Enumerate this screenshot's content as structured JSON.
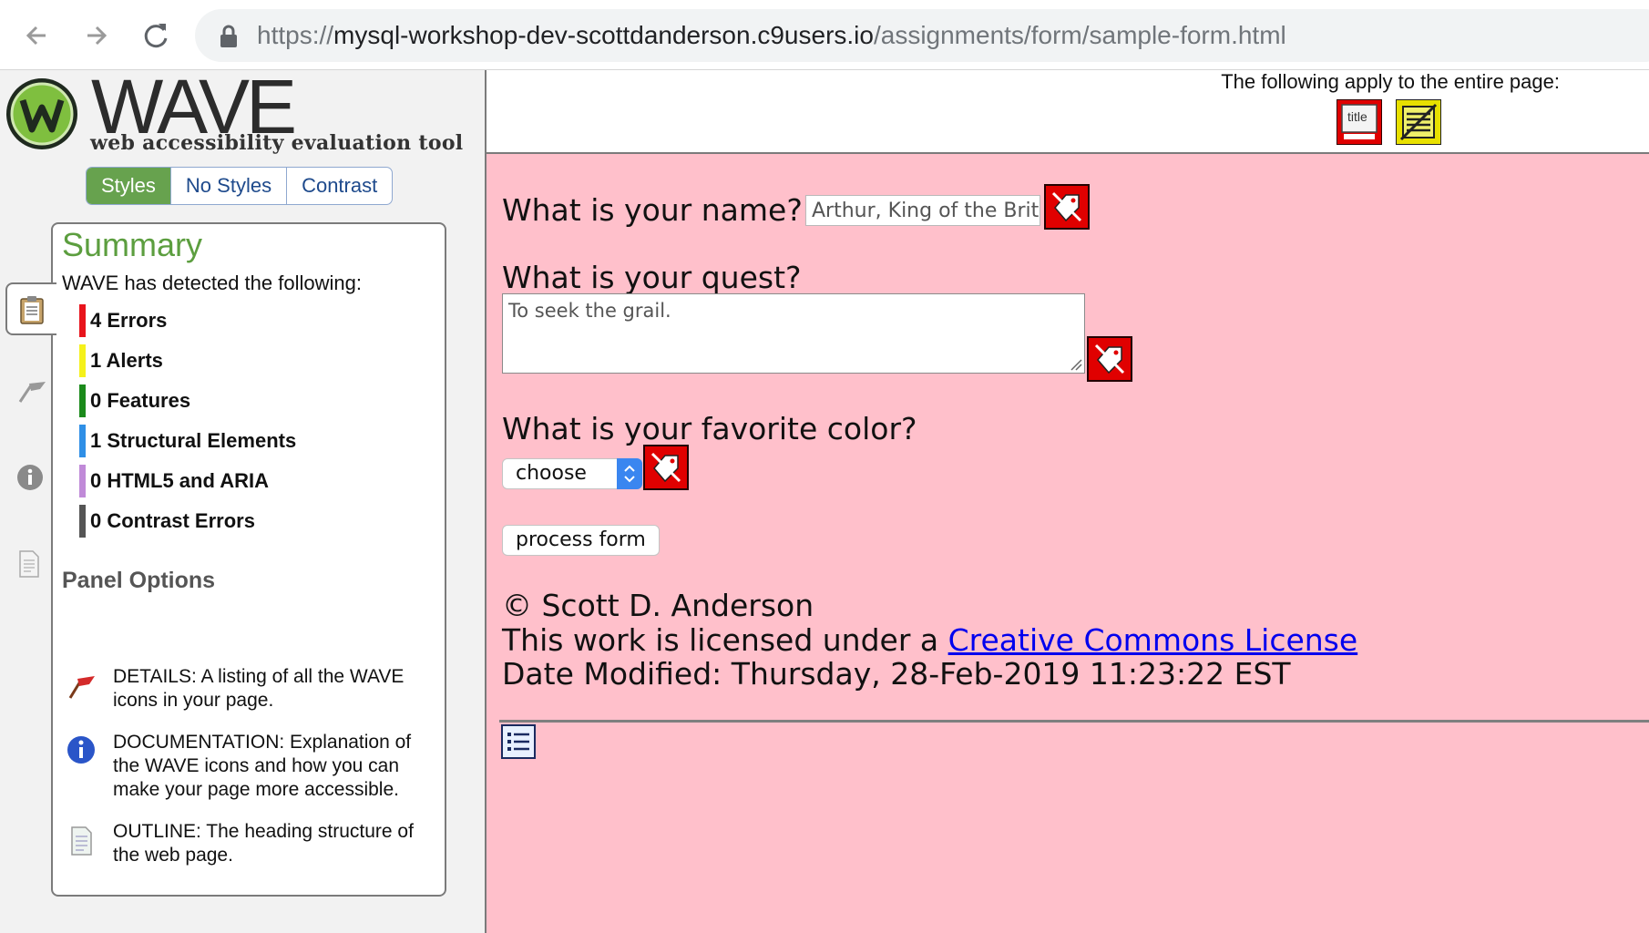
{
  "browser": {
    "url_host_prefix": "https://",
    "url_host": "mysql-workshop-dev-scottdanderson.c9users.io",
    "url_path": "/assignments/form/sample-form.html"
  },
  "wave": {
    "logo_title": "WAVE",
    "logo_subtitle": "web accessibility evaluation tool",
    "style_tabs": [
      "Styles",
      "No Styles",
      "Contrast"
    ],
    "summary": {
      "title": "Summary",
      "intro": "WAVE has detected the following:",
      "items": [
        {
          "label": "4 Errors",
          "color": "#e8141c"
        },
        {
          "label": "1 Alerts",
          "color": "#f5f11b"
        },
        {
          "label": "0 Features",
          "color": "#1b8a1b"
        },
        {
          "label": "1 Structural Elements",
          "color": "#2f8fe6"
        },
        {
          "label": "0 HTML5 and ARIA",
          "color": "#c08ad8"
        },
        {
          "label": "0 Contrast Errors",
          "color": "#555555"
        }
      ]
    },
    "panel_options": {
      "heading": "Panel Options",
      "items": [
        {
          "icon": "flag-icon",
          "text": "DETAILS: A listing of all the WAVE icons in your page."
        },
        {
          "icon": "info-icon",
          "text": "DOCUMENTATION: Explanation of the WAVE icons and how you can make your page more accessible."
        },
        {
          "icon": "outline-icon",
          "text": "OUTLINE: The heading structure of the web page."
        }
      ]
    }
  },
  "page": {
    "apply_text": "The following apply to the entire page:",
    "title_icon_text": "title",
    "q_name": "What is your name?",
    "name_value": "Arthur, King of the Brito",
    "q_quest": "What is your quest?",
    "quest_value": "To seek the grail.",
    "q_color": "What is your favorite color?",
    "select_value": "choose",
    "button_label": "process form",
    "copyright": "© Scott D. Anderson",
    "license_prefix": "This work is licensed under a ",
    "license_link": "Creative Commons License",
    "date_modified": "Date Modified: Thursday, 28-Feb-2019 11:23:22 EST"
  }
}
